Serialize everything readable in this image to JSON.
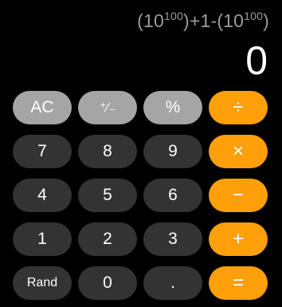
{
  "display": {
    "expression_prefix": "(10",
    "exp1": "100",
    "expression_middle": ")+1-(10",
    "exp2": "100",
    "expression_suffix": ")",
    "result": "0"
  },
  "keys": {
    "ac": "AC",
    "plus_minus": "⁺∕₋",
    "percent": "%",
    "divide": "÷",
    "seven": "7",
    "eight": "8",
    "nine": "9",
    "multiply": "×",
    "four": "4",
    "five": "5",
    "six": "6",
    "minus": "−",
    "one": "1",
    "two": "2",
    "three": "3",
    "plus": "+",
    "rand": "Rand",
    "zero": "0",
    "decimal": ".",
    "equals": "="
  },
  "colors": {
    "background": "#000000",
    "function_key": "#a5a5a5",
    "digit_key": "#333333",
    "operator_key": "#ff9f0a",
    "expression_text": "#9b9b9b"
  }
}
